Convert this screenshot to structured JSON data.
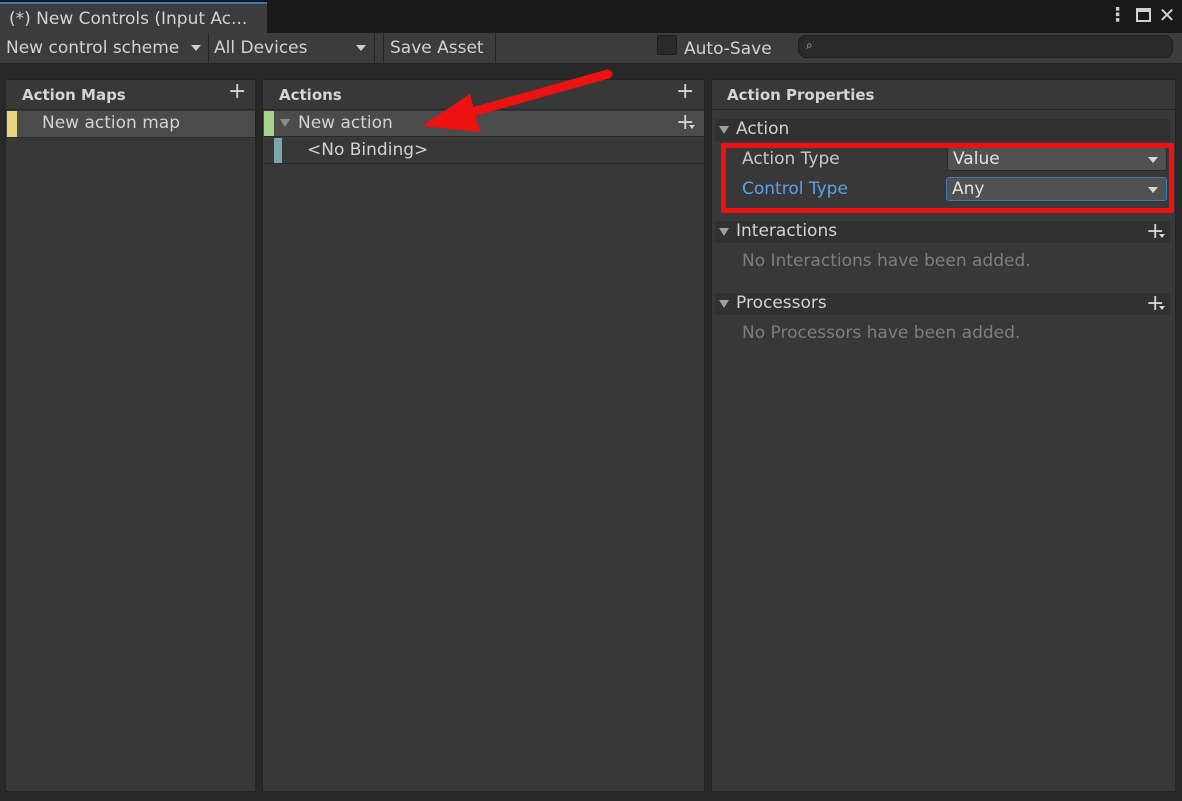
{
  "window": {
    "tab_title": "(*) New Controls (Input Ac...",
    "kebab_icon": "kebab-menu-icon",
    "maximize_icon": "maximize-icon",
    "close_icon": "close-icon"
  },
  "toolbar": {
    "control_scheme": "New control scheme",
    "devices": "All Devices",
    "save_asset": "Save Asset",
    "auto_save_label": "Auto-Save",
    "auto_save_checked": false,
    "search_placeholder": ""
  },
  "action_maps": {
    "header": "Action Maps",
    "items": [
      {
        "label": "New action map",
        "color": "#e6d57c",
        "selected": true
      }
    ]
  },
  "actions": {
    "header": "Actions",
    "items": [
      {
        "label": "New action",
        "color": "#a8d18f",
        "selected": true
      },
      {
        "label": "<No Binding>",
        "color": "#7ba6ad",
        "selected": false
      }
    ]
  },
  "properties": {
    "header": "Action Properties",
    "action_section": {
      "title": "Action",
      "action_type_label": "Action Type",
      "action_type_value": "Value",
      "control_type_label": "Control Type",
      "control_type_value": "Any"
    },
    "interactions": {
      "title": "Interactions",
      "empty_text": "No Interactions have been added."
    },
    "processors": {
      "title": "Processors",
      "empty_text": "No Processors have been added."
    }
  },
  "colors": {
    "accent_blue": "#3a79bb",
    "control_type_label": "#5fa0e8",
    "annotation_red": "#ee1111"
  },
  "annotations": {
    "arrow": "red-arrow-pointing-to-new-action",
    "box": "red-box-around-type-properties"
  }
}
